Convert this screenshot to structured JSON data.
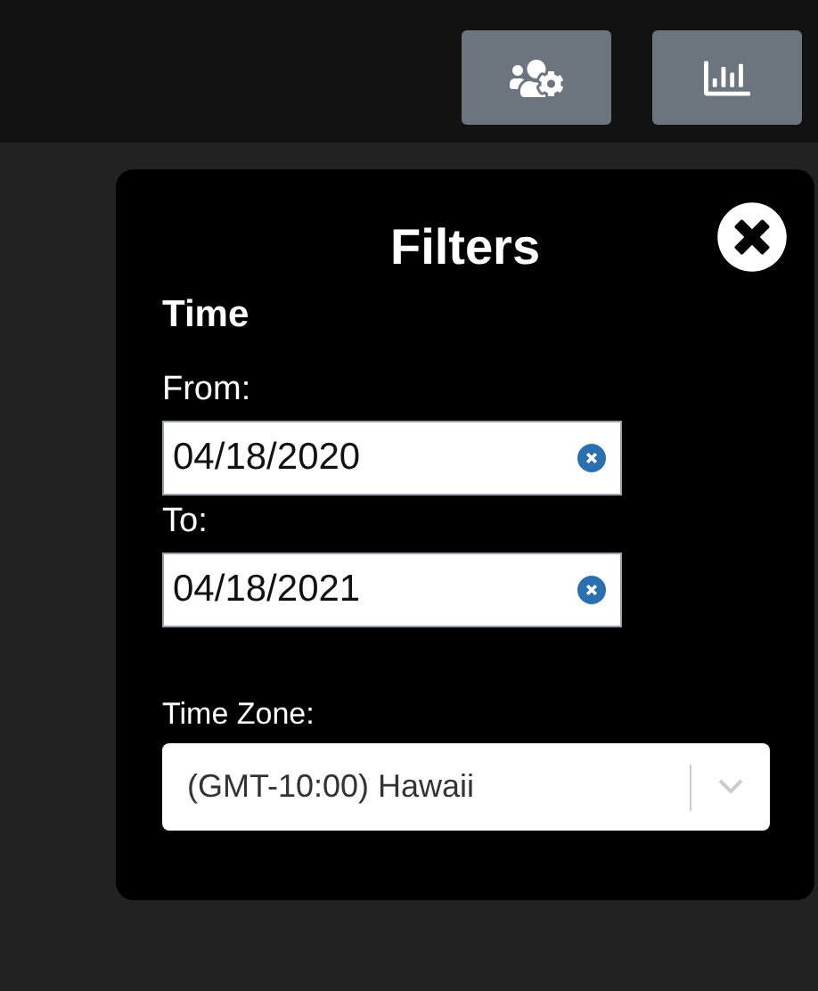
{
  "toolbar": {
    "buttons": [
      {
        "kind": "users-settings"
      },
      {
        "kind": "chart"
      }
    ]
  },
  "filters": {
    "title": "Filters",
    "section": "Time",
    "from": {
      "label": "From:",
      "value": "04/18/2020"
    },
    "to": {
      "label": "To:",
      "value": "04/18/2021"
    },
    "time_zone": {
      "label": "Time Zone:",
      "value": "(GMT-10:00) Hawaii"
    }
  }
}
